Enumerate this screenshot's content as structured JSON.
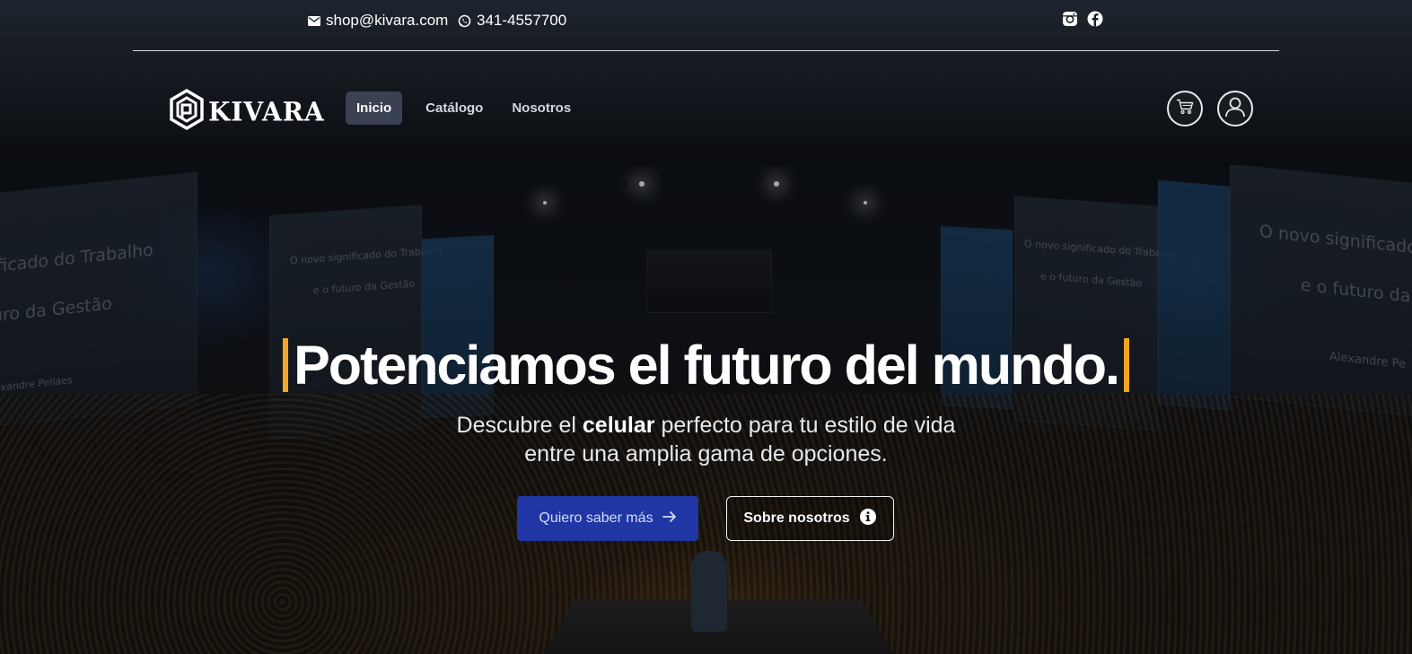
{
  "topbar": {
    "email": "shop@kivara.com",
    "phone": "341-4557700",
    "icons": [
      "mail-icon",
      "whatsapp-icon",
      "instagram-icon",
      "facebook-icon"
    ]
  },
  "brand": {
    "name": "KIVARA"
  },
  "nav": {
    "items": [
      {
        "label": "Inicio",
        "active": true
      },
      {
        "label": "Catálogo",
        "active": false
      },
      {
        "label": "Nosotros",
        "active": false
      }
    ],
    "icons": [
      "cart-icon",
      "user-icon"
    ]
  },
  "hero": {
    "title": "Potenciamos el futuro del mundo.",
    "subtitle_pre": "Descubre el ",
    "subtitle_bold": "celular",
    "subtitle_post": " perfecto para tu estilo de vida",
    "subtitle_line2": "entre una amplia gama de opciones.",
    "primary_button": "Quiero saber más",
    "secondary_button": "Sobre nosotros",
    "background_text": {
      "screen_left_1": "ificado do Trabalho",
      "screen_left_2": "uro da Gestão",
      "screen_left_3": "lexandre Pellaes",
      "screen_mid_left_1": "O novo significado do Trabalho",
      "screen_mid_left_2": "e o futuro da Gestão",
      "screen_mid_right_1": "O novo significado do Trabalho",
      "screen_mid_right_2": "e o futuro da Gestão",
      "screen_right_1": "O novo significado",
      "screen_right_2": "e o futuro da",
      "screen_right_3": "Alexandre Pe"
    }
  },
  "colors": {
    "accent_bar": "#f5a524",
    "primary_button": "#2036a5",
    "nav_active": "#3a4152"
  }
}
